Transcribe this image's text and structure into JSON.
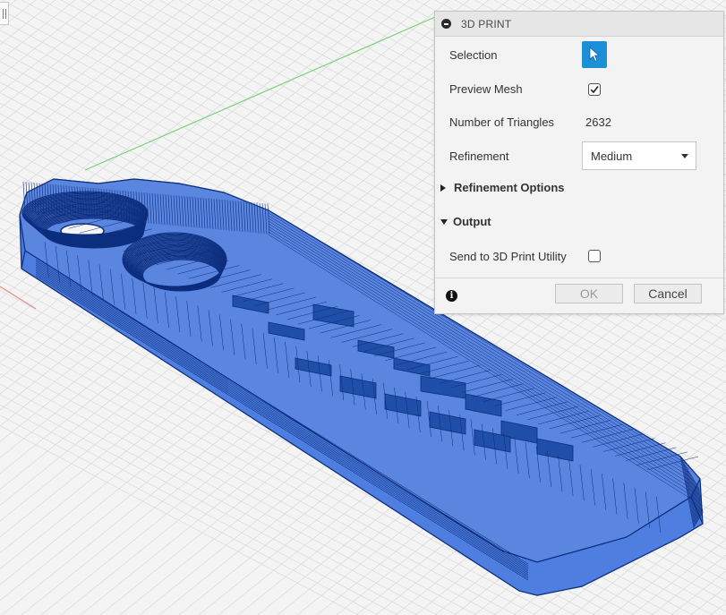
{
  "dialog": {
    "title": "3D PRINT",
    "selection_label": "Selection",
    "preview_mesh_label": "Preview Mesh",
    "preview_mesh_checked": true,
    "triangles_label": "Number of Triangles",
    "triangles_value": "2632",
    "refinement_label": "Refinement",
    "refinement_value": "Medium",
    "refinement_options_label": "Refinement Options",
    "refinement_options_expanded": false,
    "output_label": "Output",
    "output_expanded": true,
    "send_label": "Send to 3D Print Utility",
    "send_checked": false,
    "ok_label": "OK",
    "cancel_label": "Cancel"
  },
  "colors": {
    "mesh_fill": "#5b86e0",
    "mesh_edge": "#0d2e7e",
    "selection_button": "#1d8fd6",
    "grid_line": "#d9d9d9",
    "axis_green": "#7bd27b",
    "axis_red": "#e78a8a"
  },
  "icons": [
    "collapse-icon",
    "cursor-icon",
    "checkmark-icon",
    "dropdown-caret-icon",
    "expand-arrow-icon",
    "collapse-arrow-icon",
    "info-icon"
  ]
}
